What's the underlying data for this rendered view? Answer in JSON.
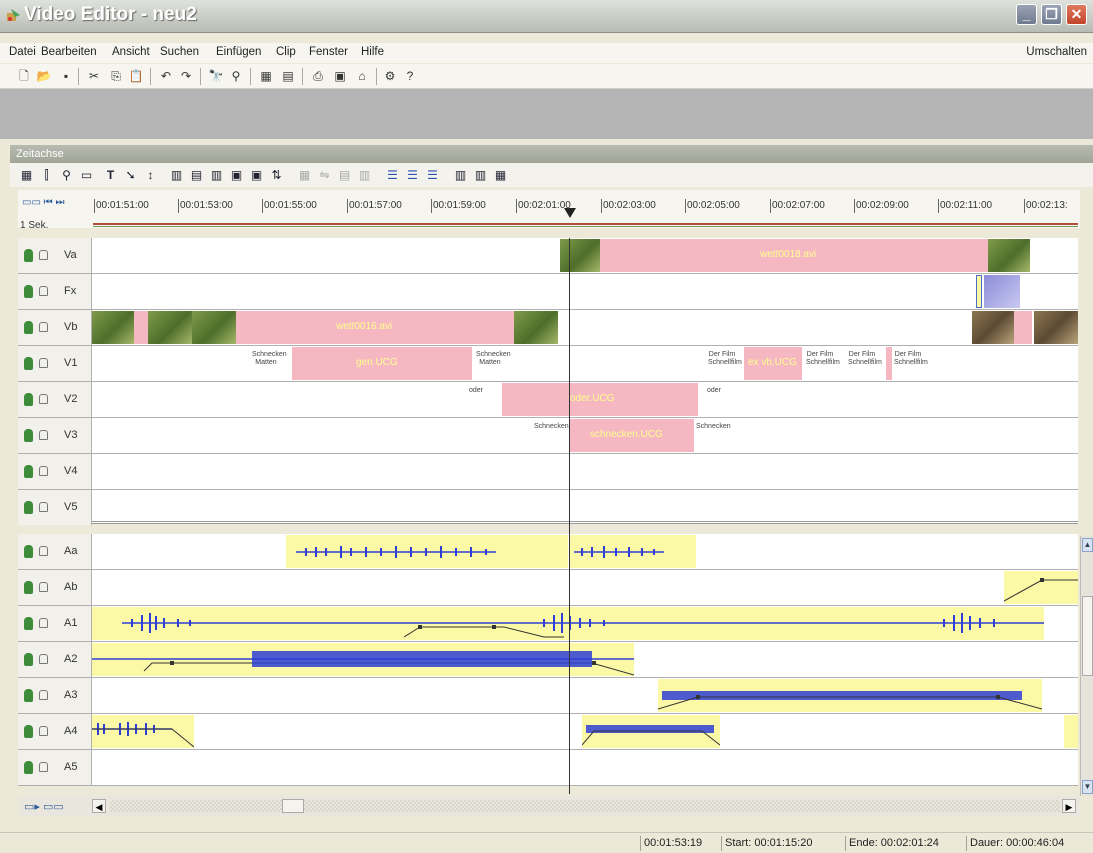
{
  "window": {
    "title": "Video Editor - neu2"
  },
  "menu": {
    "items": [
      "Datei",
      "Bearbeiten",
      "Ansicht",
      "Suchen",
      "Einfügen",
      "Clip",
      "Fenster",
      "Hilfe"
    ],
    "right": "Umschalten"
  },
  "toolbar": {
    "icons": [
      "new-icon",
      "open-icon",
      "save-icon",
      "cut-icon",
      "copy-icon",
      "paste-icon",
      "undo-icon",
      "redo-icon",
      "find-icon",
      "find-next-icon",
      "capture-icon",
      "effects-icon",
      "export-icon",
      "render-icon",
      "burn-icon",
      "tools-icon",
      "help-icon"
    ]
  },
  "timeline_panel": {
    "title": "Zeitachse",
    "scale_label": "1 Sek.",
    "ruler_ticks": [
      "00:01:51:00",
      "00:01:53:00",
      "00:01:55:00",
      "00:01:57:00",
      "00:01:59:00",
      "00:02:01:00",
      "00:02:03:00",
      "00:02:05:00",
      "00:02:07:00",
      "00:02:09:00",
      "00:02:11:00",
      "00:02:13:"
    ]
  },
  "tracks": {
    "video": [
      {
        "label": "Va"
      },
      {
        "label": "Fx"
      },
      {
        "label": "Vb"
      },
      {
        "label": "V1"
      },
      {
        "label": "V2"
      },
      {
        "label": "V3"
      },
      {
        "label": "V4"
      },
      {
        "label": "V5"
      }
    ],
    "audio": [
      {
        "label": "Aa"
      },
      {
        "label": "Ab"
      },
      {
        "label": "A1"
      },
      {
        "label": "A2"
      },
      {
        "label": "A3"
      },
      {
        "label": "A4"
      },
      {
        "label": "A5"
      }
    ]
  },
  "clips": {
    "va_clip": "wett0018.avi",
    "vb_clip": "wett0016.avi",
    "v1_clip_a": "gen.UCG",
    "v1_clip_b": "ex vb.UCG",
    "v2_clip": "oder.UCG",
    "v3_clip": "schnecken.UCG",
    "title_text_a": "Schnecken Matten",
    "title_text_b": "oder",
    "title_text_c": "Schnecken",
    "title_text_d": "Der Film Schnellfilm"
  },
  "status": {
    "position": "00:01:53:19",
    "start": "Start: 00:01:15:20",
    "end": "Ende: 00:02:01:24",
    "duration": "Dauer: 00:00:46:04"
  },
  "colors": {
    "video_clip": "#f5b8c3",
    "audio_clip": "#fbf8a6",
    "waveform": "#2f3fd6",
    "track_header": "#f1f0ea"
  }
}
